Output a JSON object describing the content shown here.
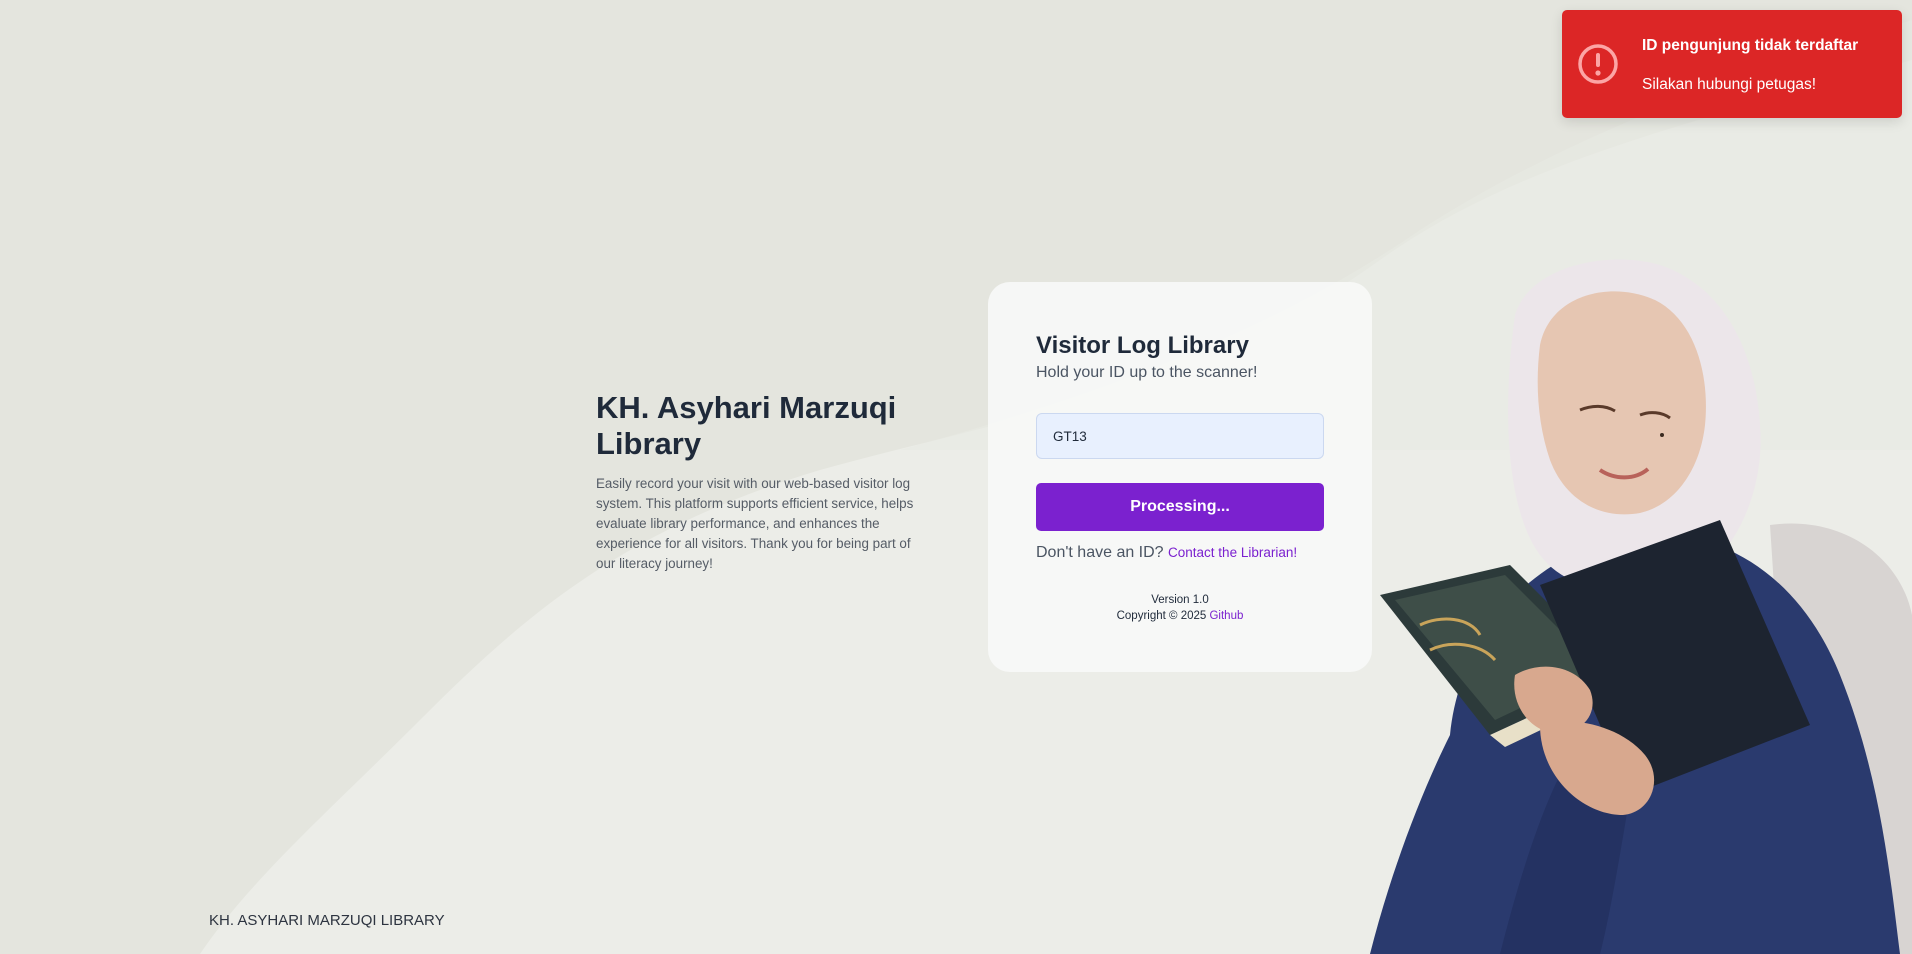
{
  "app": {
    "library_name": "KH. Asyhari Marzuqi Library",
    "description": "Easily record your visit with our web-based visitor log system. This platform supports efficient service, helps evaluate library performance, and enhances the experience for all visitors. Thank you for being part of our literacy journey!",
    "footer_brand": "KH. ASYHARI MARZUQI LIBRARY"
  },
  "card": {
    "title": "Visitor Log Library",
    "subtitle": "Hold your ID up to the scanner!",
    "id_input": {
      "value": "GT13"
    },
    "submit_label": "Processing...",
    "help_prefix": "Don't have an ID?",
    "help_link": "Contact the Librarian!",
    "version": "Version 1.0",
    "copyright": "Copyright © 2025",
    "github_link": "Github"
  },
  "toast": {
    "title": "ID pengunjung tidak terdaftar",
    "message": "Silakan hubungi petugas!",
    "icon": "exclamation-circle-icon",
    "color": "#dc2626"
  },
  "colors": {
    "accent": "#7b21cf",
    "background": "#e4e5de",
    "error": "#dc2626"
  }
}
